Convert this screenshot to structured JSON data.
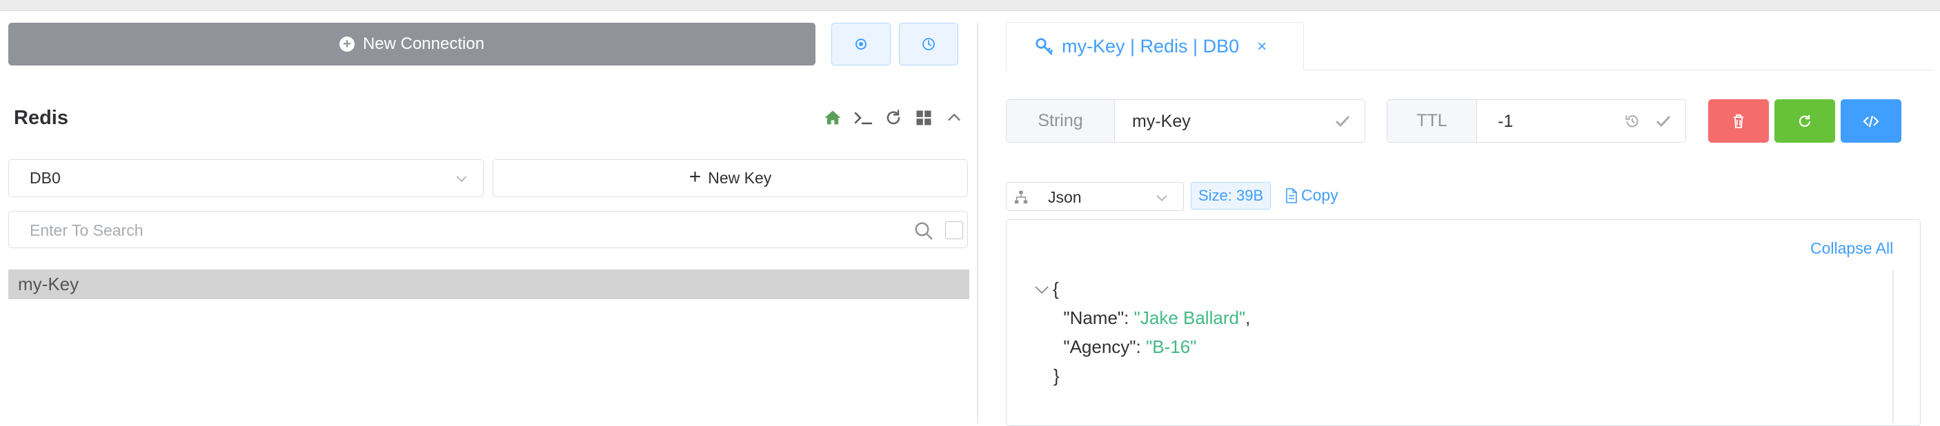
{
  "toolbar": {
    "new_connection_label": "New Connection"
  },
  "connection": {
    "name": "Redis"
  },
  "db_select": {
    "value": "DB0"
  },
  "new_key_label": "New Key",
  "search": {
    "placeholder": "Enter To Search"
  },
  "key_list": [
    {
      "name": "my-Key"
    }
  ],
  "tab": {
    "label": "my-Key | Redis | DB0",
    "close": "×"
  },
  "key_detail": {
    "type_label": "String",
    "key_name": "my-Key",
    "ttl_label": "TTL",
    "ttl_value": "-1"
  },
  "viewer": {
    "format": "Json",
    "size": "Size: 39B",
    "copy_label": "Copy",
    "collapse_label": "Collapse All"
  },
  "json_view": {
    "open": "{",
    "fields": [
      {
        "key": "\"Name\"",
        "value": "\"Jake Ballard\"",
        "sep": ","
      },
      {
        "key": "\"Agency\"",
        "value": "\"B-16\"",
        "sep": ""
      }
    ],
    "close": "}"
  },
  "colors": {
    "primary": "#409eff",
    "success": "#67c23a",
    "danger": "#f56c6c",
    "info": "#909399",
    "home_icon": "#5aa05a",
    "json_string": "#42b983"
  },
  "icons": [
    "plus-circle-icon",
    "settings-icon",
    "history-icon",
    "home-icon",
    "terminal-icon",
    "refresh-icon",
    "grid-icon",
    "collapse-icon",
    "chevron-down-icon",
    "search-icon",
    "key-icon",
    "close-icon",
    "check-icon",
    "reset-icon",
    "delete-icon",
    "code-icon",
    "tree-icon",
    "document-icon"
  ]
}
